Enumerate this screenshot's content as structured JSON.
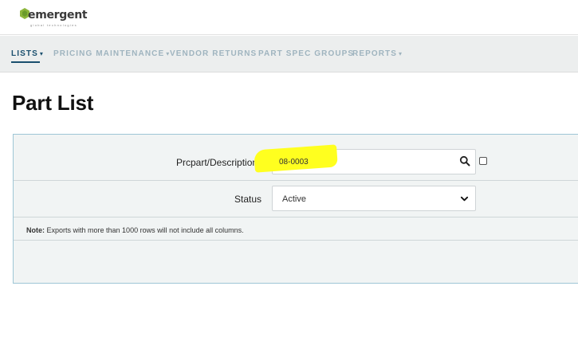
{
  "header": {
    "logo_text": "emergent",
    "logo_tagline": "global technologies"
  },
  "nav": {
    "items": [
      {
        "label": "LISTS",
        "caret": "▾",
        "active": true
      },
      {
        "label": "PRICING MAINTENANCE",
        "caret": "▾",
        "active": false
      },
      {
        "label": "VENDOR RETURNS",
        "caret": "",
        "active": false
      },
      {
        "label": "PART SPEC GROUPS",
        "caret": "",
        "active": false
      },
      {
        "label": "REPORTS",
        "caret": "▾",
        "active": false
      }
    ]
  },
  "page": {
    "title": "Part List"
  },
  "filters": {
    "part_label": "Prcpart/Description",
    "part_value": "08-0003",
    "search_icon": "search-icon",
    "checkbox_checked": false,
    "status_label": "Status",
    "status_value": "Active",
    "note_prefix": "Note:",
    "note_text": "Exports with more than 1000 rows will not include all columns."
  },
  "colors": {
    "accent": "#1a4f6e",
    "nav_inactive": "#9fb4bf",
    "highlight": "#ffff1f",
    "panel_border": "#9ec6d6",
    "logo_green": "#8bb43a"
  }
}
